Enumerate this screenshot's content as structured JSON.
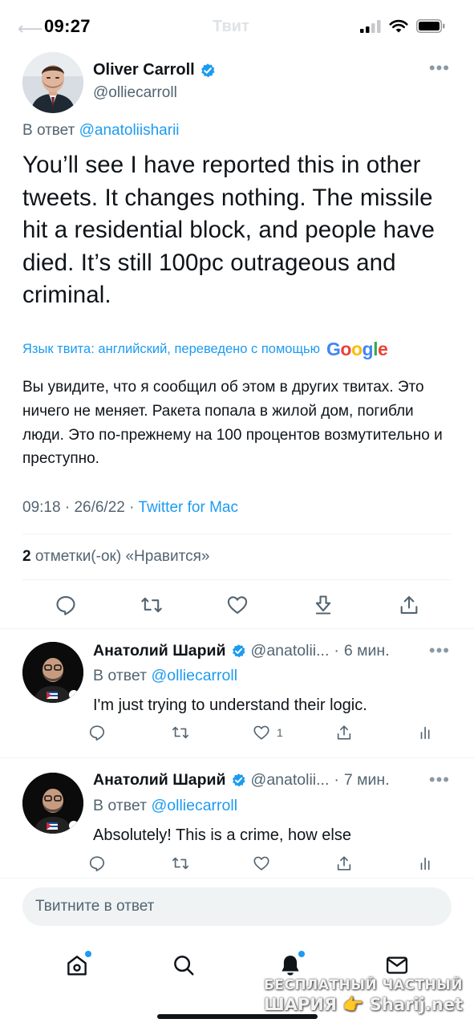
{
  "status_bar": {
    "time": "09:27",
    "ghost_title": "Твит"
  },
  "tweet": {
    "author_name": "Oliver Carroll",
    "author_handle": "@olliecarroll",
    "reply_prefix": "В ответ",
    "reply_to": "@anatoliisharii",
    "text": "You’ll see I have reported this in other tweets. It changes nothing. The missile hit a residential block, and people have died. It’s still 100pc outrageous and criminal.",
    "translation_note": "Язык твита: английский, переведено с помощью",
    "translation_provider": "Google",
    "translation": "Вы увидите, что я сообщил об этом в других твитах. Это ничего не меняет. Ракета попала в жилой дом, погибли люди. Это по-прежнему на 100 процентов возмутительно и преступно.",
    "time": "09:18",
    "date": "26/6/22",
    "source": "Twitter for Mac",
    "likes_count": "2",
    "likes_label": "отметки(-ок) «Нравится»"
  },
  "replies": [
    {
      "name": "Анатолий Шарий",
      "handle": "@anatolii...",
      "age": "6 мин.",
      "reply_prefix": "В ответ",
      "reply_to": "@olliecarroll",
      "text": "I'm just trying to understand their logic.",
      "like_count": "1"
    },
    {
      "name": "Анатолий Шарий",
      "handle": "@anatolii...",
      "age": "7 мин.",
      "reply_prefix": "В ответ",
      "reply_to": "@olliecarroll",
      "text": "Absolutely! This is a crime, how else",
      "like_count": ""
    }
  ],
  "composer": {
    "placeholder": "Твитните в ответ"
  },
  "tabbar": {
    "items": [
      "home-icon",
      "search-icon",
      "notifications-icon",
      "messages-icon"
    ]
  },
  "watermark": {
    "line1": "БЕСПЛАТНЫЙ ЧАСТНЫЙ",
    "line2": "ШАРИЯ 👉 Sharij.net"
  },
  "colors": {
    "accent": "#1d9bf0",
    "text": "#0f1419",
    "secondary": "#536471"
  }
}
